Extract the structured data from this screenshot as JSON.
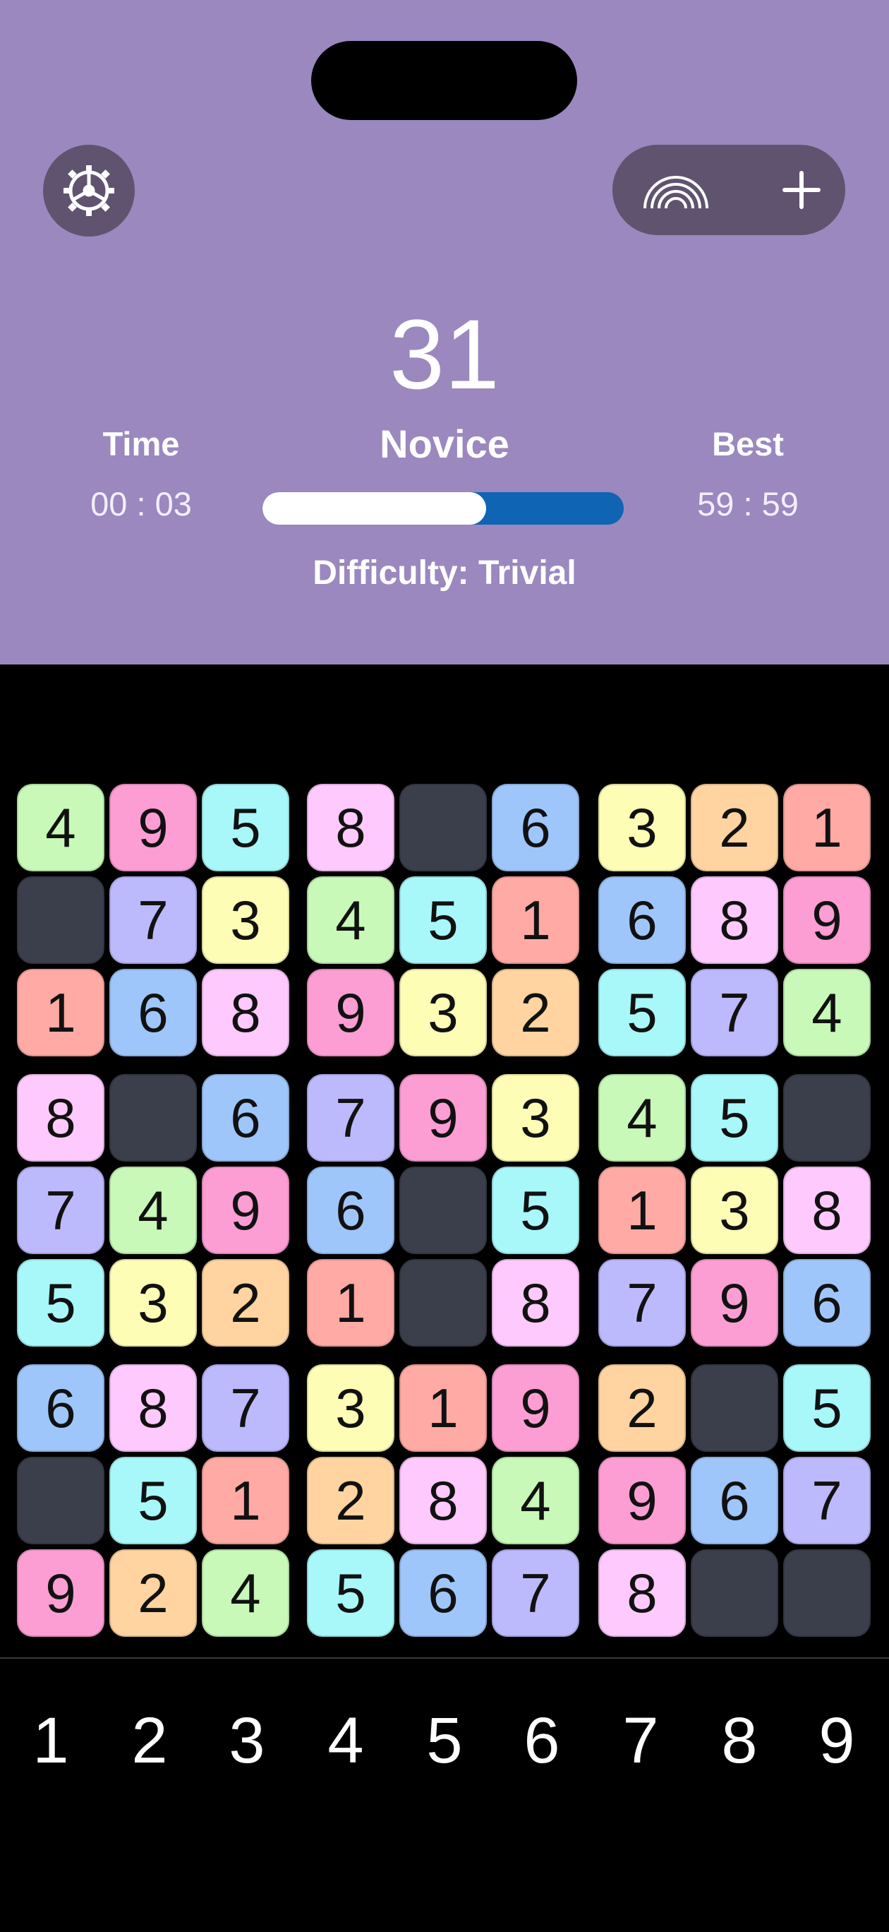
{
  "header": {
    "score": "31",
    "level": "Novice",
    "time_label": "Time",
    "time_value": "00 : 03",
    "best_label": "Best",
    "best_value": "59 : 59",
    "difficulty": "Difficulty: Trivial",
    "progress_fraction": 0.62,
    "background_color": "#9a88bf",
    "progress_color": "#0f64b3"
  },
  "icons": {
    "settings": "gear-icon",
    "theme": "rainbow-icon",
    "new_game": "plus-icon"
  },
  "board": {
    "empty_color": "#3a3f4b",
    "colors": {
      "1": "#ffaaa4",
      "2": "#ffd4a0",
      "3": "#fdfdb6",
      "4": "#c8f9b8",
      "5": "#a8f8fa",
      "6": "#9fc6fa",
      "7": "#bdb9fd",
      "8": "#fec9fd",
      "9": "#fc9ed3"
    },
    "rows": [
      [
        "4",
        "9",
        "5",
        "8",
        "",
        "6",
        "3",
        "2",
        "1"
      ],
      [
        "",
        "7",
        "3",
        "4",
        "5",
        "1",
        "6",
        "8",
        "9"
      ],
      [
        "1",
        "6",
        "8",
        "9",
        "3",
        "2",
        "5",
        "7",
        "4"
      ],
      [
        "8",
        "",
        "6",
        "7",
        "9",
        "3",
        "4",
        "5",
        ""
      ],
      [
        "7",
        "4",
        "9",
        "6",
        "",
        "5",
        "1",
        "3",
        "8"
      ],
      [
        "5",
        "3",
        "2",
        "1",
        "",
        "8",
        "7",
        "9",
        "6"
      ],
      [
        "6",
        "8",
        "7",
        "3",
        "1",
        "9",
        "2",
        "",
        "5"
      ],
      [
        "",
        "5",
        "1",
        "2",
        "8",
        "4",
        "9",
        "6",
        "7"
      ],
      [
        "9",
        "2",
        "4",
        "5",
        "6",
        "7",
        "8",
        "",
        ""
      ]
    ]
  },
  "number_pad": [
    "1",
    "2",
    "3",
    "4",
    "5",
    "6",
    "7",
    "8",
    "9"
  ]
}
